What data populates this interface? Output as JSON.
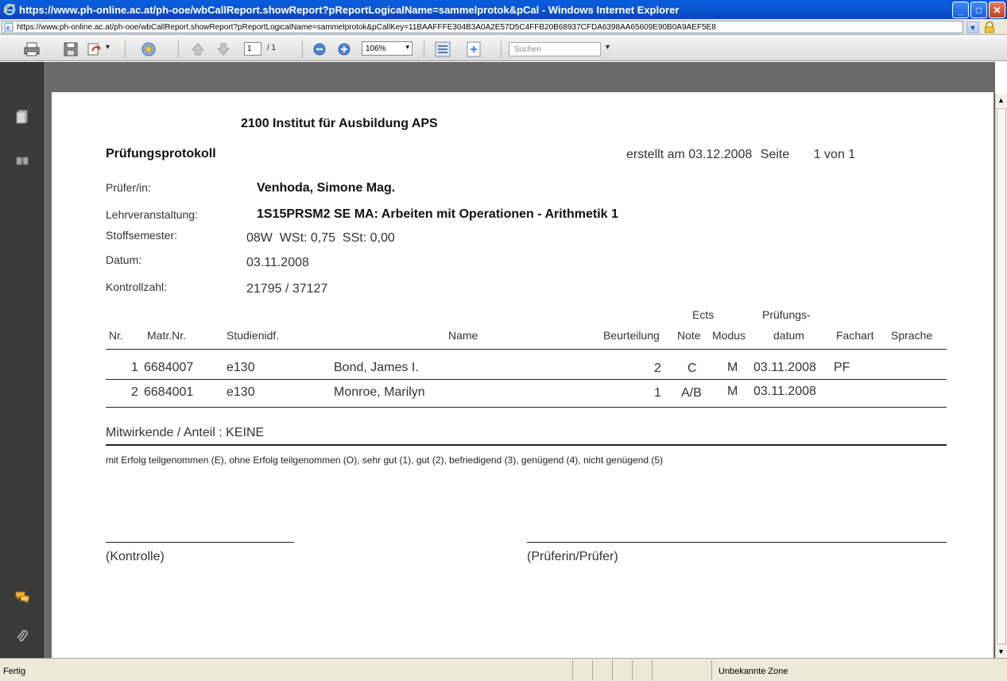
{
  "window": {
    "title": "https://www.ph-online.ac.at/ph-ooe/wbCallReport.showReport?pReportLogicalName=sammelprotok&pCal - Windows Internet Explorer",
    "address": "https://www.ph-online.ac.at/ph-ooe/wbCallReport.showReport?pReportLogicalName=sammelprotok&pCallKey=11BAAFFFE304B3A0A2E57D5C4FFB20B68937CFDA6398AA65609E90B0A9AEF5E8"
  },
  "toolbar": {
    "page_current": "1",
    "page_total": "/ 1",
    "zoom": "106%",
    "search_placeholder": "Suchen"
  },
  "report": {
    "institute": "2100 Institut für Ausbildung APS",
    "title": "Prüfungsprotokoll",
    "created_label": "erstellt am",
    "created_date": "03.12.2008",
    "page_label": "Seite",
    "page_info": "1 von 1",
    "fields": {
      "pruefer_label": "Prüfer/in:",
      "pruefer_value": "Venhoda, Simone Mag.",
      "lv_label": "Lehrveranstaltung:",
      "lv_value": "1S15PRSM2 SE MA: Arbeiten mit Operationen - Arithmetik 1",
      "stoff_label": "Stoffsemester:",
      "stoff_value": "08W  WSt: 0,75  SSt: 0,00",
      "datum_label": "Datum:",
      "datum_value": "03.11.2008",
      "kontroll_label": "Kontrollzahl:",
      "kontroll_value": "21795 / 37127"
    },
    "table": {
      "headers": {
        "nr": "Nr.",
        "matr": "Matr.Nr.",
        "studienidf": "Studienidf.",
        "name": "Name",
        "beurteilung": "Beurteilung",
        "ects_top": "Ects",
        "ects_bottom": "Note",
        "modus": "Modus",
        "pdatum_top": "Prüfungs-",
        "pdatum_bottom": "datum",
        "fachart": "Fachart",
        "sprache": "Sprache"
      },
      "rows": [
        {
          "nr": "1",
          "matr": "6684007",
          "studienidf": "e130",
          "name": "Bond, James I.",
          "beurteilung": "2",
          "ects": "C",
          "modus": "M",
          "datum": "03.11.2008",
          "fachart": "PF"
        },
        {
          "nr": "2",
          "matr": "6684001",
          "studienidf": "e130",
          "name": "Monroe, Marilyn",
          "beurteilung": "1",
          "ects": "A/B",
          "modus": "M",
          "datum": "03.11.2008",
          "fachart": ""
        }
      ]
    },
    "mitwirkende": "Mitwirkende / Anteil : KEINE",
    "legend": "mit Erfolg teilgenommen (E), ohne Erfolg teilgenommen (O), sehr gut (1), gut (2), befriedigend (3), genügend (4), nicht genügend (5)",
    "sig_kontrolle": "(Kontrolle)",
    "sig_pruefer": "(Prüferin/Prüfer)"
  },
  "statusbar": {
    "status": "Fertig",
    "zone": "Unbekannte Zone"
  }
}
